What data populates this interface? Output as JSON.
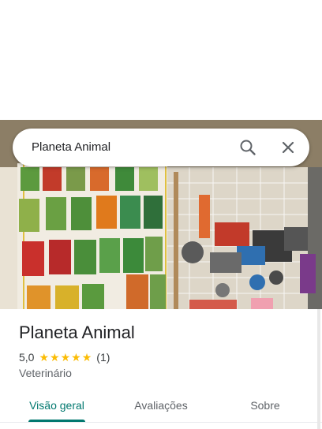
{
  "search": {
    "query": "Planeta Animal"
  },
  "place": {
    "name": "Planeta Animal",
    "rating": "5,0",
    "stars": 5,
    "review_count": "(1)",
    "category": "Veterinário"
  },
  "tabs": [
    {
      "label": "Visão geral",
      "active": true
    },
    {
      "label": "Avaliações",
      "active": false
    },
    {
      "label": "Sobre",
      "active": false
    }
  ],
  "colors": {
    "accent": "#01786f",
    "star": "#fbbc04"
  }
}
